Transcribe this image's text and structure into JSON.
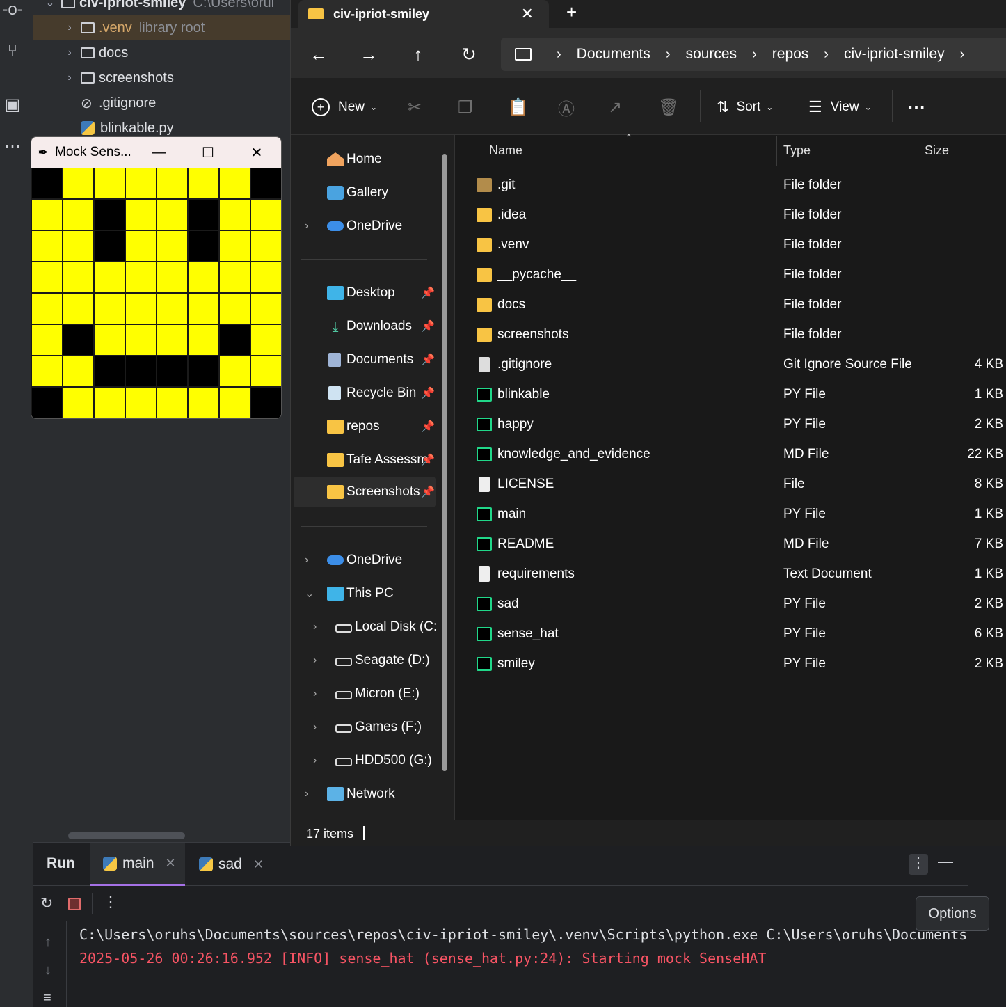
{
  "ide": {
    "project_root": {
      "name": "civ-ipriot-smiley",
      "path": "C:\\Users\\orul"
    },
    "tree": [
      {
        "label": ".venv",
        "hint": "library root"
      },
      {
        "label": "docs"
      },
      {
        "label": "screenshots"
      },
      {
        "label": ".gitignore"
      },
      {
        "label": "blinkable.py"
      }
    ],
    "run": {
      "title": "Run",
      "tabs": [
        {
          "label": "main"
        },
        {
          "label": "sad"
        }
      ],
      "console": [
        "C:\\Users\\oruhs\\Documents\\sources\\repos\\civ-ipriot-smiley\\.venv\\Scripts\\python.exe C:\\Users\\oruhs\\Documents",
        "2025-05-26 00:26:16.952 [INFO] sense_hat (sense_hat.py:24): Starting mock SenseHAT"
      ],
      "options_label": "Options"
    }
  },
  "mock_window": {
    "title": "Mock Sens...",
    "on_color": "#ffff00",
    "off_color": "#000000",
    "pixels": [
      [
        0,
        1,
        1,
        1,
        1,
        1,
        1,
        0
      ],
      [
        1,
        1,
        0,
        1,
        1,
        0,
        1,
        1
      ],
      [
        1,
        1,
        0,
        1,
        1,
        0,
        1,
        1
      ],
      [
        1,
        1,
        1,
        1,
        1,
        1,
        1,
        1
      ],
      [
        1,
        1,
        1,
        1,
        1,
        1,
        1,
        1
      ],
      [
        1,
        0,
        1,
        1,
        1,
        1,
        0,
        1
      ],
      [
        1,
        1,
        0,
        0,
        0,
        0,
        1,
        1
      ],
      [
        0,
        1,
        1,
        1,
        1,
        1,
        1,
        0
      ]
    ]
  },
  "explorer": {
    "tab_title": "civ-ipriot-smiley",
    "breadcrumb": [
      "Documents",
      "sources",
      "repos",
      "civ-ipriot-smiley"
    ],
    "commands": {
      "new": "New",
      "sort": "Sort",
      "view": "View"
    },
    "nav": {
      "home": "Home",
      "gallery": "Gallery",
      "onedrive": "OneDrive",
      "desktop": "Desktop",
      "downloads": "Downloads",
      "documents": "Documents",
      "recycle_bin": "Recycle Bin",
      "repos": "repos",
      "tafe": "Tafe Assessm",
      "screenshots": "Screenshots",
      "onedrive2": "OneDrive",
      "this_pc": "This PC",
      "drive_c": "Local Disk (C:)",
      "drive_d": "Seagate (D:)",
      "drive_e": "Micron (E:)",
      "drive_f": "Games (F:)",
      "drive_g": "HDD500 (G:)",
      "network": "Network"
    },
    "columns": {
      "name": "Name",
      "type": "Type",
      "size": "Size"
    },
    "files": [
      {
        "name": ".git",
        "type": "File folder",
        "size": "",
        "icon": "git"
      },
      {
        "name": ".idea",
        "type": "File folder",
        "size": "",
        "icon": "folder"
      },
      {
        "name": ".venv",
        "type": "File folder",
        "size": "",
        "icon": "folder"
      },
      {
        "name": "__pycache__",
        "type": "File folder",
        "size": "",
        "icon": "folder"
      },
      {
        "name": "docs",
        "type": "File folder",
        "size": "",
        "icon": "folder"
      },
      {
        "name": "screenshots",
        "type": "File folder",
        "size": "",
        "icon": "folder"
      },
      {
        "name": ".gitignore",
        "type": "Git Ignore Source File",
        "size": "4 KB",
        "icon": "gear"
      },
      {
        "name": "blinkable",
        "type": "PY File",
        "size": "1 KB",
        "icon": "pc"
      },
      {
        "name": "happy",
        "type": "PY File",
        "size": "2 KB",
        "icon": "pc"
      },
      {
        "name": "knowledge_and_evidence",
        "type": "MD File",
        "size": "22 KB",
        "icon": "pc"
      },
      {
        "name": "LICENSE",
        "type": "File",
        "size": "8 KB",
        "icon": "doc"
      },
      {
        "name": "main",
        "type": "PY File",
        "size": "1 KB",
        "icon": "pc"
      },
      {
        "name": "README",
        "type": "MD File",
        "size": "7 KB",
        "icon": "pc"
      },
      {
        "name": "requirements",
        "type": "Text Document",
        "size": "1 KB",
        "icon": "doc"
      },
      {
        "name": "sad",
        "type": "PY File",
        "size": "2 KB",
        "icon": "pc"
      },
      {
        "name": "sense_hat",
        "type": "PY File",
        "size": "6 KB",
        "icon": "pc"
      },
      {
        "name": "smiley",
        "type": "PY File",
        "size": "2 KB",
        "icon": "pc"
      }
    ],
    "status": "17 items"
  }
}
